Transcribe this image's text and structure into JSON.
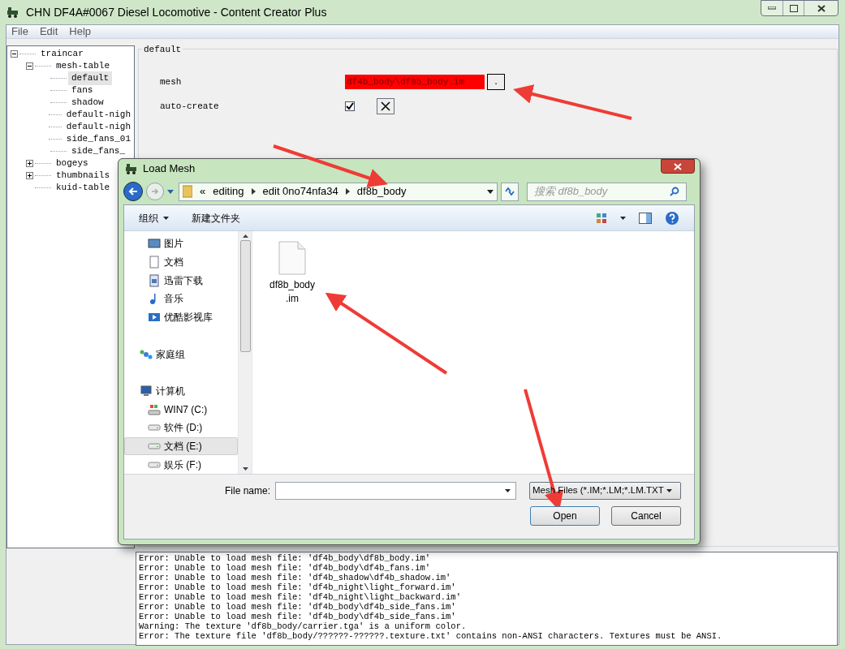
{
  "window": {
    "title": "CHN DF4A#0067 Diesel Locomotive - Content Creator Plus"
  },
  "menu": [
    "File",
    "Edit",
    "Help"
  ],
  "tree": [
    {
      "label": "traincar",
      "expanded": true,
      "selected": false,
      "children": [
        {
          "label": "mesh-table",
          "expanded": true,
          "selected": false,
          "children": [
            {
              "label": "default",
              "selected": true
            },
            {
              "label": "fans",
              "selected": false
            },
            {
              "label": "shadow",
              "selected": false
            },
            {
              "label": "default-nigh",
              "selected": false
            },
            {
              "label": "default-nigh",
              "selected": false
            },
            {
              "label": "side_fans_01",
              "selected": false
            },
            {
              "label": "side_fans_",
              "selected": false
            }
          ]
        },
        {
          "label": "bogeys",
          "expanded": false,
          "selected": false
        },
        {
          "label": "thumbnails",
          "expanded": false,
          "selected": false
        },
        {
          "label": "kuid-table",
          "selected": false
        }
      ]
    }
  ],
  "panel": {
    "title": "default",
    "mesh": {
      "label": "mesh",
      "value": "df4b_body\\df8b_body.im",
      "error": true,
      "button": "."
    },
    "auto_create": {
      "label": "auto-create",
      "checked": true
    }
  },
  "log": [
    "Error: Unable to load mesh file: 'df4b_body\\df8b_body.im'",
    "Error: Unable to load mesh file: 'df4b_body\\df4b_fans.im'",
    "Error: Unable to load mesh file: 'df4b_shadow\\df4b_shadow.im'",
    "Error: Unable to load mesh file: 'df4b_night\\light_forward.im'",
    "Error: Unable to load mesh file: 'df4b_night\\light_backward.im'",
    "Error: Unable to load mesh file: 'df4b_body\\df4b_side_fans.im'",
    "Error: Unable to load mesh file: 'df4b_body\\df4b_side_fans.im'",
    "Warning: The texture 'df8b_body/carrier.tga' is a uniform color.",
    "Error: The texture file 'df8b_body/??????-??????.texture.txt' contains non-ANSI characters. Textures must be ANSI."
  ],
  "dialog": {
    "title": "Load Mesh",
    "breadcrumb": [
      "«",
      "editing",
      "edit 0no74nfa34",
      "df8b_body"
    ],
    "search": {
      "placeholder": "搜索 df8b_body"
    },
    "toolbar": [
      "组织",
      "新建文件夹"
    ],
    "nav": [
      {
        "label": "图片",
        "kind": "pictures",
        "selected": false
      },
      {
        "label": "文档",
        "kind": "documents",
        "selected": false
      },
      {
        "label": "迅雷下载",
        "kind": "downloads",
        "selected": false
      },
      {
        "label": "音乐",
        "kind": "music",
        "selected": false
      },
      {
        "label": "优酷影视库",
        "kind": "video",
        "selected": false
      },
      {
        "label": "家庭组",
        "kind": "homegroup",
        "selected": false
      },
      {
        "label": "计算机",
        "kind": "computer",
        "selected": false
      },
      {
        "label": "WIN7 (C:)",
        "kind": "system-drive",
        "selected": false
      },
      {
        "label": "软件 (D:)",
        "kind": "drive",
        "selected": false
      },
      {
        "label": "文档 (E:)",
        "kind": "drive",
        "selected": true
      },
      {
        "label": "娱乐 (F:)",
        "kind": "drive",
        "selected": false
      }
    ],
    "files": [
      {
        "name": "df8b_body\n.im"
      }
    ],
    "file_name": {
      "label": "File name:"
    },
    "file_type": "Mesh Files (*.IM;*.LM;*.LM.TXT",
    "buttons": [
      "Open",
      "Cancel"
    ]
  }
}
